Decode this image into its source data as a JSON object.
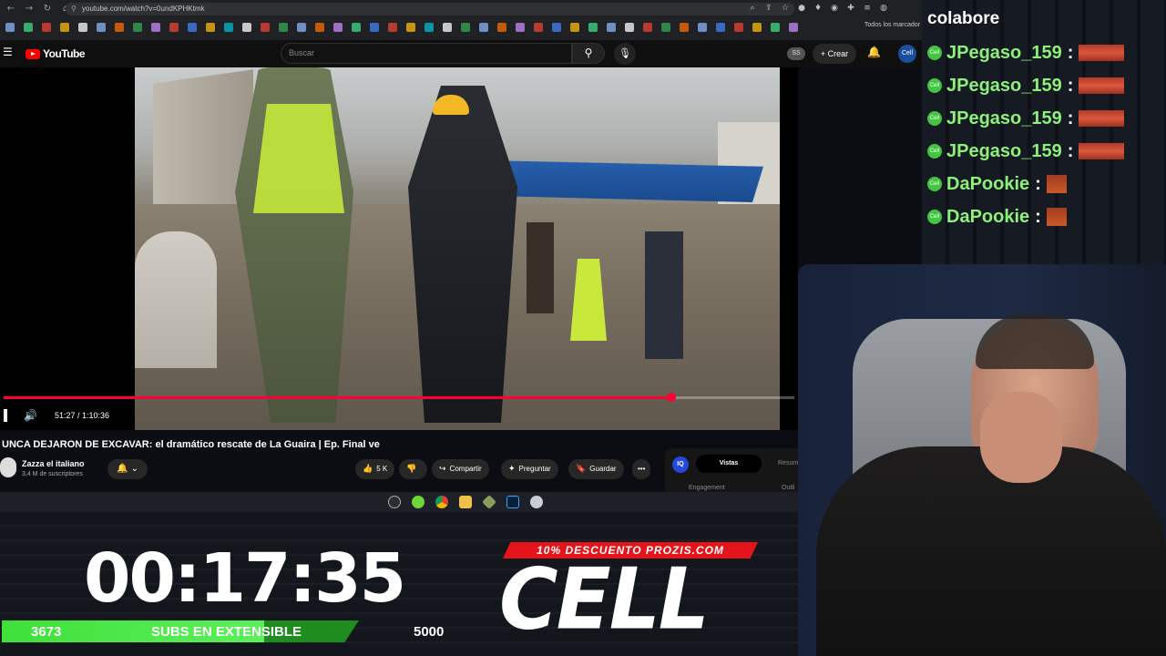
{
  "browser": {
    "url": "youtube.com/watch?v=0undKPHKtmk",
    "bookmarks_all": "Todos los marcador"
  },
  "youtube": {
    "logo_text": "YouTube",
    "search_placeholder": "Buscar",
    "badge": "SS",
    "create_label": "+ Crear",
    "avatar_text": "Cell"
  },
  "player": {
    "time": "51:27 / 1:10:36",
    "progress": 0.845
  },
  "video": {
    "title": "UNCA DEJARON DE EXCAVAR: el dramático rescate de La Guaira | Ep. Final ve",
    "channel": "Zazza el italiano",
    "subscribers": "3,4 M de suscriptores",
    "likes": "5 K",
    "share_label": "Compartir",
    "ask_label": "Preguntar",
    "save_label": "Guardar"
  },
  "side_panel": {
    "iq": "IQ",
    "tab_active": "Vistas",
    "tab_other": "Resum",
    "label_left": "Engagement",
    "label_right": "Outli"
  },
  "stream": {
    "countdown": "00:17:35",
    "subs_current": "3673",
    "subs_label": "SUBS EN EXTENSIBLE",
    "subs_goal": "5000",
    "subs_progress": 0.7346,
    "promo": "10% DESCUENTO PROZIS.COM",
    "logo_text": "CELL"
  },
  "chat": {
    "header": "colabore",
    "badge_text": "Cell",
    "messages": [
      {
        "user": "JPegaso_159",
        "sep": ":"
      },
      {
        "user": "JPegaso_159",
        "sep": ":"
      },
      {
        "user": "JPegaso_159",
        "sep": ":"
      },
      {
        "user": "JPegaso_159",
        "sep": ":"
      },
      {
        "user": "DaPookie",
        "sep": ":"
      },
      {
        "user": "DaPookie",
        "sep": ":"
      }
    ]
  }
}
